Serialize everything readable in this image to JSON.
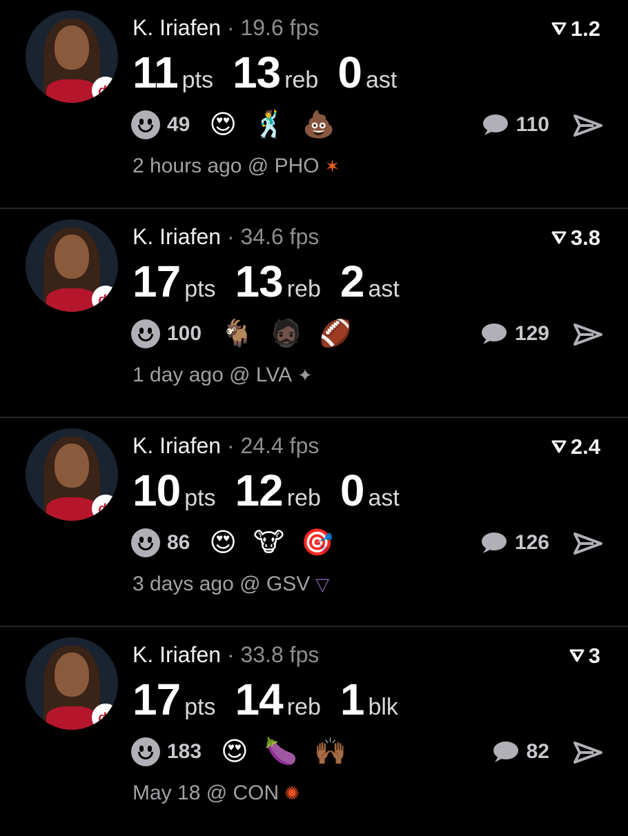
{
  "feed": [
    {
      "player": "K. Iriafen",
      "fps": "19.6 fps",
      "rank": "1.2",
      "stats": [
        {
          "value": "11",
          "unit": "pts"
        },
        {
          "value": "13",
          "unit": "reb"
        },
        {
          "value": "0",
          "unit": "ast"
        }
      ],
      "reaction_count": "49",
      "emojis": [
        "😍",
        "🕺",
        "💩"
      ],
      "comment_count": "110",
      "time_opponent": "2 hours ago @ PHO",
      "team_logo": "phoenix-logo"
    },
    {
      "player": "K. Iriafen",
      "fps": "34.6 fps",
      "rank": "3.8",
      "stats": [
        {
          "value": "17",
          "unit": "pts"
        },
        {
          "value": "13",
          "unit": "reb"
        },
        {
          "value": "2",
          "unit": "ast"
        }
      ],
      "reaction_count": "100",
      "emojis": [
        "🐐",
        "🧔🏿",
        "🏈"
      ],
      "comment_count": "129",
      "time_opponent": "1 day ago @ LVA",
      "team_logo": "las-vegas-logo"
    },
    {
      "player": "K. Iriafen",
      "fps": "24.4 fps",
      "rank": "2.4",
      "stats": [
        {
          "value": "10",
          "unit": "pts"
        },
        {
          "value": "12",
          "unit": "reb"
        },
        {
          "value": "0",
          "unit": "ast"
        }
      ],
      "reaction_count": "86",
      "emojis": [
        "😍",
        "🐮",
        "🎯"
      ],
      "comment_count": "126",
      "time_opponent": "3 days ago @ GSV",
      "team_logo": "golden-state-logo"
    },
    {
      "player": "K. Iriafen",
      "fps": "33.8 fps",
      "rank": "3",
      "stats": [
        {
          "value": "17",
          "unit": "pts"
        },
        {
          "value": "14",
          "unit": "reb"
        },
        {
          "value": "1",
          "unit": "blk"
        }
      ],
      "reaction_count": "183",
      "emojis": [
        "😍",
        "🍆",
        "🙌🏾"
      ],
      "comment_count": "82",
      "time_opponent": "May 18 @ CON",
      "team_logo": "connecticut-logo"
    }
  ],
  "colors": {
    "background": "#000000",
    "muted_text": "#8e8e93",
    "divider": "#262626"
  }
}
